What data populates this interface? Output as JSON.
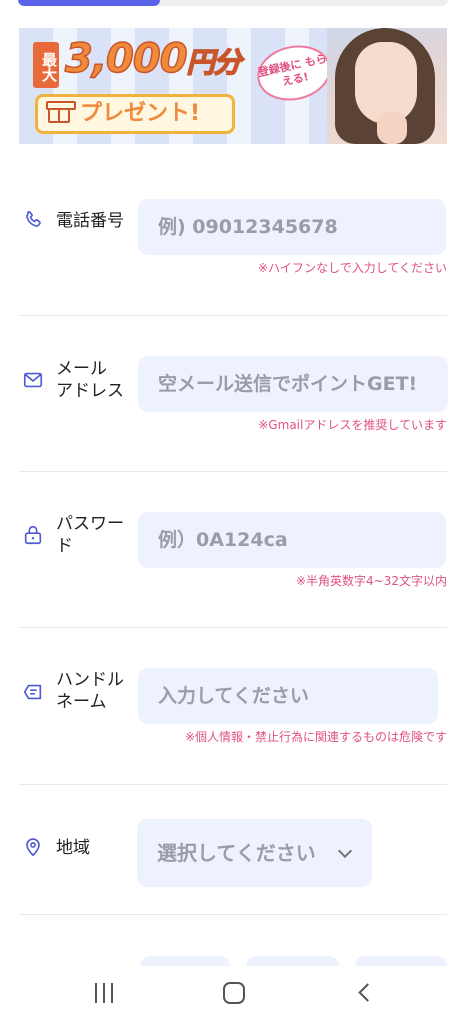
{
  "progress": {
    "fraction": 0.33
  },
  "banner": {
    "badge": "最大",
    "amount": "3,000",
    "unit": "円分",
    "present": "プレゼント!",
    "bubble": "登録後に もらえる!"
  },
  "form": {
    "phone": {
      "icon": "phone-icon",
      "label": "電話番号",
      "placeholder": "例) 09012345678",
      "hint": "※ハイフンなしで入力してください"
    },
    "email": {
      "icon": "mail-icon",
      "label": "メール\nアドレス",
      "placeholder": "空メール送信でポイントGET!",
      "hint": "※Gmailアドレスを推奨しています"
    },
    "password": {
      "icon": "lock-icon",
      "label": "パスワー\nド",
      "placeholder": "例）0A124ca",
      "hint": "※半角英数字4~32文字以内"
    },
    "handle": {
      "icon": "tag-icon",
      "label": "ハンドル\nネーム",
      "placeholder": "入力してください",
      "hint": "※個人情報・禁止行為に関連するものは危険です"
    },
    "region": {
      "icon": "location-pin-icon",
      "label": "地域",
      "selected": "選択してください"
    }
  },
  "colors": {
    "accent": "#5b63e8",
    "field_bg": "#eef2ff",
    "hint": "#e0527f",
    "icon": "#4f5bd5"
  }
}
